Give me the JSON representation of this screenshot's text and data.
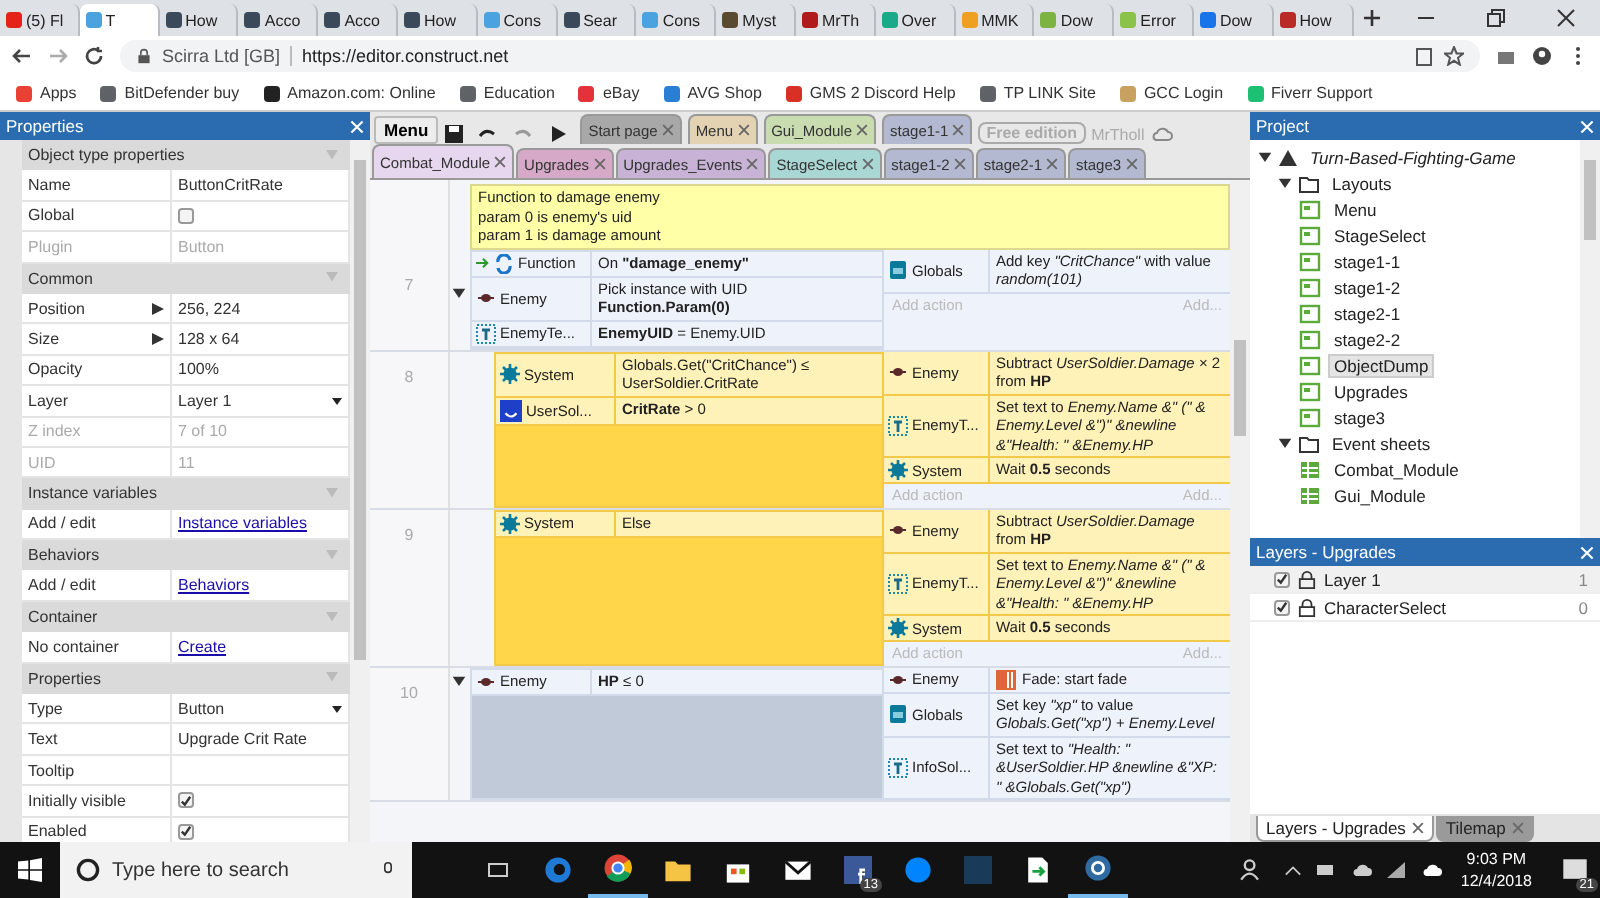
{
  "browser": {
    "tabs": [
      {
        "label": "(5) Fl",
        "selected": false,
        "color": "#e62117"
      },
      {
        "label": "T",
        "selected": true,
        "color": "#4aa3df"
      },
      {
        "label": "How",
        "selected": false,
        "color": "#3b4a5a"
      },
      {
        "label": "Acco",
        "selected": false,
        "color": "#3b4a5a"
      },
      {
        "label": "Acco",
        "selected": false,
        "color": "#3b4a5a"
      },
      {
        "label": "How",
        "selected": false,
        "color": "#3b4a5a"
      },
      {
        "label": "Cons",
        "selected": false,
        "color": "#4aa3df"
      },
      {
        "label": "Sear",
        "selected": false,
        "color": "#3b4a5a"
      },
      {
        "label": "Cons",
        "selected": false,
        "color": "#4aa3df"
      },
      {
        "label": "Myst",
        "selected": false,
        "color": "#5a4a30"
      },
      {
        "label": "MrTh",
        "selected": false,
        "color": "#b11a1a"
      },
      {
        "label": "Over",
        "selected": false,
        "color": "#1aaa8a"
      },
      {
        "label": "MMK",
        "selected": false,
        "color": "#f0a020"
      },
      {
        "label": "Dow",
        "selected": false,
        "color": "#7cb342"
      },
      {
        "label": "Error",
        "selected": false,
        "color": "#8bc34a"
      },
      {
        "label": "Dow",
        "selected": false,
        "color": "#1a73e8"
      },
      {
        "label": "How",
        "selected": false,
        "color": "#b92b27"
      }
    ],
    "site": "Scirra Ltd [GB]",
    "url": "https://editor.construct.net",
    "bookmarks": [
      {
        "label": "Apps",
        "color": "#e94235"
      },
      {
        "label": "BitDefender buy",
        "color": "#5f6368"
      },
      {
        "label": "Amazon.com: Online",
        "color": "#222222"
      },
      {
        "label": "Education",
        "color": "#5f6368"
      },
      {
        "label": "eBay",
        "color": "#e53238"
      },
      {
        "label": "AVG Shop",
        "color": "#2a7fd4"
      },
      {
        "label": "GMS 2 Discord Help",
        "color": "#d93025"
      },
      {
        "label": "TP LINK Site",
        "color": "#5f6368"
      },
      {
        "label": "GCC Login",
        "color": "#c8a060"
      },
      {
        "label": "Fiverr Support",
        "color": "#1dbf73"
      }
    ]
  },
  "toolbar": {
    "menu": "Menu",
    "edition": "Free edition",
    "user": "MrTholl"
  },
  "sheet_tabs": [
    [
      {
        "label": "Start page",
        "selected": false,
        "color": "#a8a8a8"
      },
      {
        "label": "Menu",
        "selected": false,
        "color": "#e3d3b3"
      },
      {
        "label": "Gui_Module",
        "selected": false,
        "color": "#c9dcb0"
      },
      {
        "label": "stage1-1",
        "selected": false,
        "color": "#b3b9d1"
      }
    ],
    [
      {
        "label": "Combat_Module",
        "selected": true,
        "color": "#e6d6ee"
      },
      {
        "label": "Upgrades",
        "selected": false,
        "color": "#d7a9c8"
      },
      {
        "label": "Upgrades_Events",
        "selected": false,
        "color": "#c8b3d6"
      },
      {
        "label": "StageSelect",
        "selected": false,
        "color": "#a9d7d3"
      },
      {
        "label": "stage1-2",
        "selected": false,
        "color": "#b3b9d1"
      },
      {
        "label": "stage2-1",
        "selected": false,
        "color": "#b3b9d1"
      },
      {
        "label": "stage3",
        "selected": false,
        "color": "#b3b9d1"
      }
    ]
  ],
  "properties": {
    "title": "Properties",
    "sections": [
      {
        "title": "Object type properties",
        "rows": [
          {
            "kind": "text",
            "label": "Name",
            "value": "ButtonCritRate",
            "disabled": false
          },
          {
            "kind": "check",
            "label": "Global",
            "checked": false,
            "disabled": false
          },
          {
            "kind": "text",
            "label": "Plugin",
            "value": "Button",
            "disabled": true
          }
        ]
      },
      {
        "title": "Common",
        "rows": [
          {
            "kind": "expand",
            "label": "Position",
            "value": "256, 224",
            "disabled": false
          },
          {
            "kind": "expand",
            "label": "Size",
            "value": "128 x 64",
            "disabled": false
          },
          {
            "kind": "text",
            "label": "Opacity",
            "value": "100%",
            "disabled": false
          },
          {
            "kind": "dropdown",
            "label": "Layer",
            "value": "Layer 1",
            "disabled": false
          },
          {
            "kind": "text",
            "label": "Z index",
            "value": "7 of 10",
            "disabled": true
          },
          {
            "kind": "text",
            "label": "UID",
            "value": "11",
            "disabled": true
          }
        ]
      },
      {
        "title": "Instance variables",
        "rows": [
          {
            "kind": "link",
            "label": "Add / edit",
            "value": "Instance variables",
            "disabled": false
          }
        ]
      },
      {
        "title": "Behaviors",
        "rows": [
          {
            "kind": "link",
            "label": "Add / edit",
            "value": "Behaviors",
            "disabled": false
          }
        ]
      },
      {
        "title": "Container",
        "rows": [
          {
            "kind": "link",
            "label": "No container",
            "value": "Create",
            "disabled": false
          }
        ]
      },
      {
        "title": "Properties",
        "rows": [
          {
            "kind": "dropdown",
            "label": "Type",
            "value": "Button",
            "disabled": false
          },
          {
            "kind": "text",
            "label": "Text",
            "value": "Upgrade Crit Rate",
            "disabled": false
          },
          {
            "kind": "text",
            "label": "Tooltip",
            "disabled": false
          },
          {
            "kind": "check",
            "label": "Initially visible",
            "checked": true,
            "disabled": false
          },
          {
            "kind": "check",
            "label": "Enabled",
            "checked": true,
            "disabled": false
          }
        ]
      }
    ]
  },
  "events": [
    {
      "number": "7",
      "expanded": true,
      "selected": false,
      "comment": [
        "Function to damage enemy",
        "param 0 is enemy's uid",
        "param 1 is damage amount"
      ],
      "conditions": [
        {
          "object": "Function",
          "kind": "function",
          "trigger": true,
          "text": "On **\"damage_enemy\"**"
        },
        {
          "object": "Enemy",
          "kind": "enemy",
          "trigger": false,
          "text": "Pick instance with UID **Function.Param(0)**"
        },
        {
          "object": "EnemyTe...",
          "kind": "text",
          "trigger": false,
          "text": "**EnemyUID** = Enemy.UID"
        }
      ],
      "actions": [
        {
          "object": "Globals",
          "kind": "dictionary",
          "fade": false,
          "text": "Add key *\"CritChance\"* with value *random(101)*"
        }
      ],
      "add_action": "Add action",
      "add_more": "Add...",
      "children": [
        {
          "number": "8",
          "selected": true,
          "conditions": [
            {
              "object": "System",
              "kind": "system",
              "trigger": false,
              "text": "Globals.Get(\"CritChance\") ≤ UserSoldier.CritRate"
            },
            {
              "object": "UserSol...",
              "kind": "sprite",
              "trigger": false,
              "text": "**CritRate** > 0"
            }
          ],
          "actions": [
            {
              "object": "Enemy",
              "kind": "enemy",
              "fade": false,
              "text": "Subtract *UserSoldier.Damage* × 2 from **HP**"
            },
            {
              "object": "EnemyT...",
              "kind": "text",
              "fade": false,
              "text": "Set text to *Enemy.Name &\" (\" & Enemy.Level &\")\" &newline &\"Health: \" &Enemy.HP*"
            },
            {
              "object": "System",
              "kind": "system",
              "fade": false,
              "text": "Wait **0.5** seconds"
            }
          ],
          "add_action": "Add action",
          "add_more": "Add..."
        },
        {
          "number": "9",
          "selected": true,
          "conditions": [
            {
              "object": "System",
              "kind": "system",
              "trigger": false,
              "text": "Else"
            }
          ],
          "actions": [
            {
              "object": "Enemy",
              "kind": "enemy",
              "fade": false,
              "text": "Subtract *UserSoldier.Damage* from **HP**"
            },
            {
              "object": "EnemyT...",
              "kind": "text",
              "fade": false,
              "text": "Set text to *Enemy.Name &\" (\" & Enemy.Level &\")\" &newline &\"Health: \" &Enemy.HP*"
            },
            {
              "object": "System",
              "kind": "system",
              "fade": false,
              "text": "Wait **0.5** seconds"
            }
          ],
          "add_action": "Add action",
          "add_more": "Add..."
        }
      ]
    },
    {
      "number": "10",
      "expanded": true,
      "selected": false,
      "conditions": [
        {
          "object": "Enemy",
          "kind": "enemy",
          "trigger": false,
          "text": "**HP** ≤ 0"
        }
      ],
      "actions": [
        {
          "object": "Enemy",
          "kind": "enemy",
          "fade": true,
          "text": "Fade: start fade"
        },
        {
          "object": "Globals",
          "kind": "dictionary",
          "fade": false,
          "text": "Set key *\"xp\"* to value *Globals.Get(\"xp\") + Enemy.Level*"
        },
        {
          "object": "InfoSol...",
          "kind": "text",
          "fade": false,
          "text": "Set text to *\"Health: \" &UserSoldier.HP &newline &\"XP: \" &Globals.Get(\"xp\")*"
        }
      ]
    }
  ],
  "project": {
    "title": "Project",
    "tree": [
      {
        "label": "Turn-Based-Fighting-Game",
        "kind": "project",
        "expanded": true,
        "selected": false,
        "children": [
          {
            "label": "Layouts",
            "kind": "folder",
            "expanded": true,
            "selected": false,
            "children": [
              {
                "label": "Menu",
                "kind": "layout",
                "selected": false
              },
              {
                "label": "StageSelect",
                "kind": "layout",
                "selected": false
              },
              {
                "label": "stage1-1",
                "kind": "layout",
                "selected": false
              },
              {
                "label": "stage1-2",
                "kind": "layout",
                "selected": false
              },
              {
                "label": "stage2-1",
                "kind": "layout",
                "selected": false
              },
              {
                "label": "stage2-2",
                "kind": "layout",
                "selected": false
              },
              {
                "label": "ObjectDump",
                "kind": "layout",
                "selected": true
              },
              {
                "label": "Upgrades",
                "kind": "layout",
                "selected": false
              },
              {
                "label": "stage3",
                "kind": "layout",
                "selected": false
              }
            ]
          },
          {
            "label": "Event sheets",
            "kind": "folder",
            "expanded": true,
            "selected": false,
            "children": [
              {
                "label": "Combat_Module",
                "kind": "sheet",
                "selected": false
              },
              {
                "label": "Gui_Module",
                "kind": "sheet",
                "selected": false
              }
            ]
          }
        ]
      }
    ]
  },
  "layers": {
    "title": "Layers - Upgrades",
    "items": [
      {
        "name": "Layer 1",
        "count": "1",
        "visible": true,
        "selected": true
      },
      {
        "name": "CharacterSelect",
        "count": "0",
        "visible": true,
        "selected": false
      }
    ]
  },
  "bottom_tabs": [
    {
      "label": "Layers - Upgrades",
      "selected": true
    },
    {
      "label": "Tilemap",
      "selected": false
    }
  ],
  "taskbar": {
    "search": "Type here to search",
    "badge": "13",
    "time": "9:03 PM",
    "date": "12/4/2018",
    "notifications": "21"
  }
}
